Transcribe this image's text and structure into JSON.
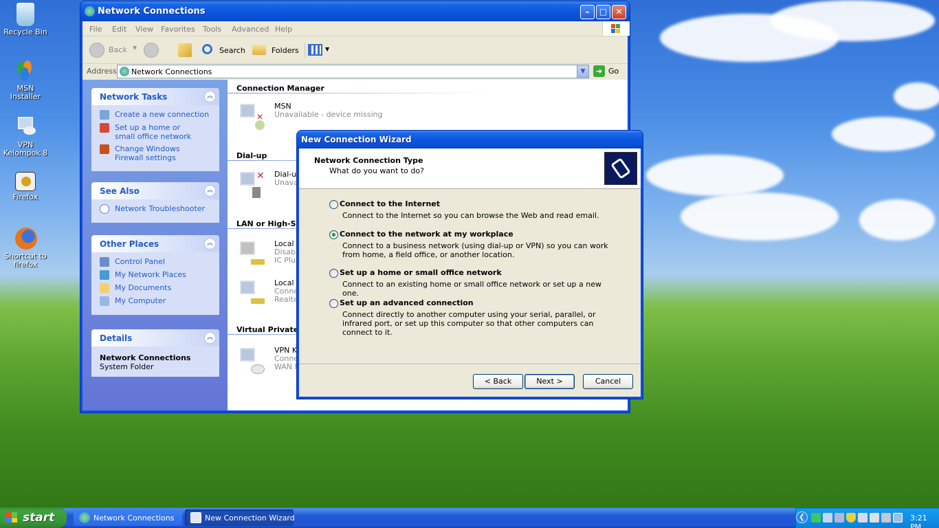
{
  "desktop": {
    "icons": [
      {
        "label": "Recycle Bin",
        "icon": "recycle-bin-icon"
      },
      {
        "label": "MSN Installer",
        "icon": "msn-icon"
      },
      {
        "label": "VPN Kelompok 8",
        "icon": "network-connection-icon"
      },
      {
        "label": "Firefox",
        "icon": "firefox-shortcut-icon"
      },
      {
        "label": "Shortcut to firefox",
        "icon": "firefox-icon"
      }
    ]
  },
  "explorer": {
    "title": "Network Connections",
    "menu": [
      "File",
      "Edit",
      "View",
      "Favorites",
      "Tools",
      "Advanced",
      "Help"
    ],
    "toolbar": {
      "back": "Back",
      "search": "Search",
      "folders": "Folders"
    },
    "address": {
      "label": "Address",
      "value": "Network Connections",
      "go": "Go"
    },
    "panels": {
      "network_tasks": {
        "title": "Network Tasks",
        "links": [
          "Create a new connection",
          "Set up a home or small office network",
          "Change Windows Firewall settings"
        ]
      },
      "see_also": {
        "title": "See Also",
        "links": [
          "Network Troubleshooter"
        ]
      },
      "other_places": {
        "title": "Other Places",
        "links": [
          "Control Panel",
          "My Network Places",
          "My Documents",
          "My Computer"
        ]
      },
      "details": {
        "title": "Details",
        "name": "Network Connections",
        "type": "System Folder"
      }
    },
    "sections": {
      "connection_manager": "Connection Manager",
      "dialup": "Dial-up",
      "lan": "LAN or High-Spe",
      "vpn": "Virtual Private N"
    },
    "connections": {
      "msn": {
        "name": "MSN",
        "status": "Unavailable - device missing"
      },
      "dialup": {
        "name": "Dial-up",
        "status": "Unava"
      },
      "lan1": {
        "name": "Local A",
        "status": "Disable",
        "device": "IC Plus"
      },
      "lan2": {
        "name": "Local A",
        "status": "Conne",
        "device": "Realte"
      },
      "vpn": {
        "name": "VPN Ke",
        "status": "Conne",
        "device": "WAN M"
      }
    }
  },
  "wizard": {
    "title": "New Connection Wizard",
    "heading": "Network Connection Type",
    "subheading": "What do you want to do?",
    "options": [
      {
        "label": "Connect to the Internet",
        "desc": "Connect to the Internet so you can browse the Web and read email.",
        "selected": false
      },
      {
        "label": "Connect to the network at my workplace",
        "desc": "Connect to a business network (using dial-up or VPN) so you can work from home, a field office, or another location.",
        "selected": true
      },
      {
        "label": "Set up a home or small office network",
        "desc": "Connect to an existing home or small office network or set up a new one.",
        "selected": false
      },
      {
        "label": "Set up an advanced connection",
        "desc": "Connect directly to another computer using your serial, parallel, or infrared port, or set up this computer so that other computers can connect to it.",
        "selected": false
      }
    ],
    "buttons": {
      "back": "< Back",
      "next": "Next >",
      "cancel": "Cancel"
    }
  },
  "taskbar": {
    "start": "start",
    "tasks": [
      "Network Connections",
      "New Connection Wizard"
    ],
    "clock": "3:21 PM"
  },
  "colors": {
    "xp_blue": "#0a4ee2",
    "link_blue": "#215dc6",
    "start_green": "#3ea33e",
    "dialog_bg": "#ece9d8"
  }
}
